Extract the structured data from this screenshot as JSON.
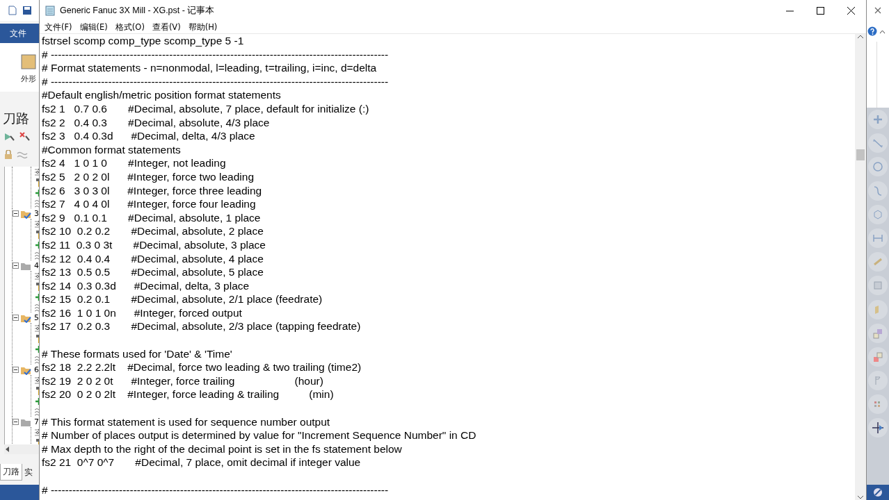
{
  "host_app": {
    "file_tab": "文件",
    "ribbon_button": "外形",
    "panel_title": "刀路",
    "tree": [
      {
        "label": "3",
        "checked": true
      },
      {
        "label": "4",
        "checked": false
      },
      {
        "label": "5",
        "checked": true
      },
      {
        "label": "6",
        "checked": true
      },
      {
        "label": "7",
        "checked": false
      }
    ],
    "bottom_tabs": [
      {
        "label": "刀路",
        "selected": true
      },
      {
        "label": "实",
        "selected": false
      }
    ]
  },
  "notepad": {
    "title": "Generic Fanuc 3X Mill - XG.pst - 记事本",
    "menu": [
      "文件(F)",
      "编辑(E)",
      "格式(O)",
      "查看(V)",
      "帮助(H)"
    ],
    "lines": [
      {
        "kind": "text",
        "text": "fstrsel scomp comp_type scomp_type 5 -1"
      },
      {
        "kind": "text",
        "text": "# ----------------------------------------------------------------------------------------------"
      },
      {
        "kind": "text",
        "text": "# Format statements - n=nonmodal, l=leading, t=trailing, i=inc, d=delta"
      },
      {
        "kind": "text",
        "text": "# ----------------------------------------------------------------------------------------------"
      },
      {
        "kind": "text",
        "text": "#Default english/metric position format statements"
      },
      {
        "kind": "text",
        "text": "fs2 1   0.7 0.6       #Decimal, absolute, 7 place, default for initialize (:)"
      },
      {
        "kind": "text",
        "text": "fs2 2   0.4 0.3       #Decimal, absolute, 4/3 place"
      },
      {
        "kind": "text",
        "text": "fs2 3   0.4 0.3d      #Decimal, delta, 4/3 place"
      },
      {
        "kind": "text",
        "text": "#Common format statements"
      },
      {
        "kind": "text",
        "text": "fs2 4   1 0 1 0       #Integer, not leading"
      },
      {
        "kind": "text",
        "text": "fs2 5   2 0 2 0l      #Integer, force two leading"
      },
      {
        "kind": "text",
        "text": "fs2 6   3 0 3 0l      #Integer, force three leading"
      },
      {
        "kind": "text",
        "text": "fs2 7   4 0 4 0l      #Integer, force four leading"
      },
      {
        "kind": "text",
        "text": "fs2 9   0.1 0.1       #Decimal, absolute, 1 place"
      },
      {
        "kind": "text",
        "text": "fs2 10  0.2 0.2       #Decimal, absolute, 2 place"
      },
      {
        "kind": "text",
        "text": "fs2 11  0.3 0 3t       #Decimal, absolute, 3 place"
      },
      {
        "kind": "text",
        "text": "fs2 12  0.4 0.4       #Decimal, absolute, 4 place"
      },
      {
        "kind": "text",
        "text": "fs2 13  0.5 0.5       #Decimal, absolute, 5 place"
      },
      {
        "kind": "text",
        "text": "fs2 14  0.3 0.3d      #Decimal, delta, 3 place"
      },
      {
        "kind": "text",
        "text": "fs2 15  0.2 0.1       #Decimal, absolute, 2/1 place (feedrate)"
      },
      {
        "kind": "text",
        "text": "fs2 16  1 0 1 0n      #Integer, forced output"
      },
      {
        "kind": "text",
        "text": "fs2 17  0.2 0.3       #Decimal, absolute, 2/3 place (tapping feedrate)"
      },
      {
        "kind": "blank"
      },
      {
        "kind": "text",
        "text": "# These formats used for 'Date' & 'Time'"
      },
      {
        "kind": "text",
        "text": "fs2 18  2.2 2.2lt    #Decimal, force two leading & two trailing (time2)"
      },
      {
        "kind": "text",
        "text": "fs2 19  2 0 2 0t      #Integer, force trailing                    (hour)"
      },
      {
        "kind": "text",
        "text": "fs2 20  0 2 0 2lt    #Integer, force leading & trailing          (min)"
      },
      {
        "kind": "blank"
      },
      {
        "kind": "text",
        "text": "# This format statement is used for sequence number output"
      },
      {
        "kind": "text",
        "text": "# Number of places output is determined by value for \"Increment Sequence Number\" in CD"
      },
      {
        "kind": "text",
        "text": "# Max depth to the right of the decimal point is set in the fs statement below"
      },
      {
        "kind": "text",
        "text": "fs2 21  0^7 0^7       #Decimal, 7 place, omit decimal if integer value"
      },
      {
        "kind": "blank"
      },
      {
        "kind": "text",
        "text": "# ----------------------------------------------------------------------------------------------"
      }
    ]
  }
}
